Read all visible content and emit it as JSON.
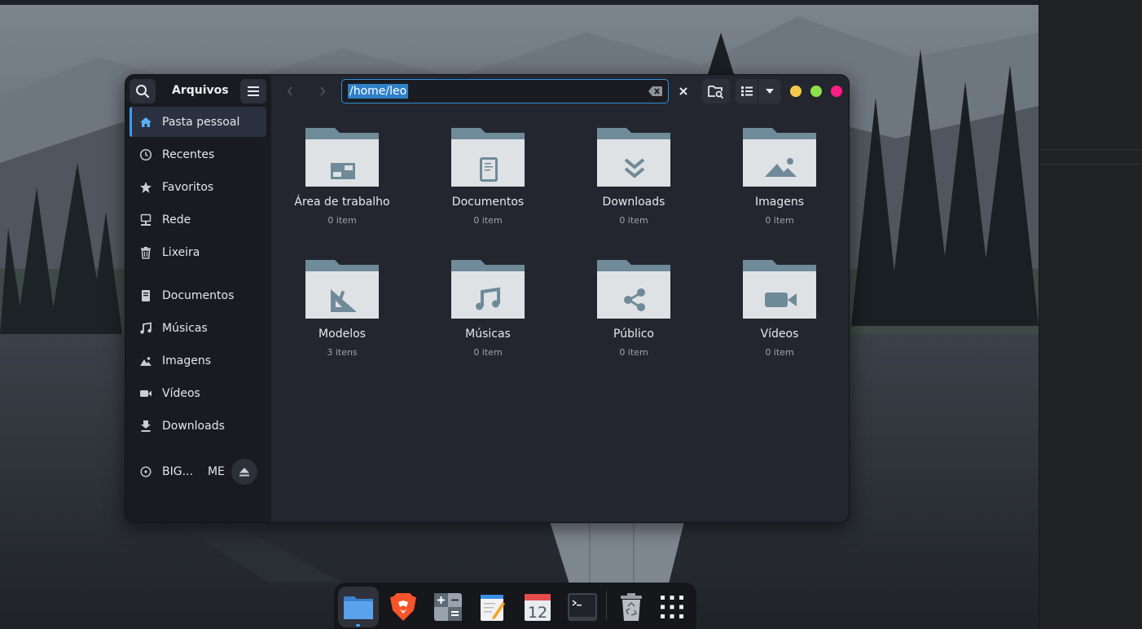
{
  "window": {
    "title": "Arquivos",
    "path": "/home/leo"
  },
  "colors": {
    "accent": "#3d9df3",
    "folder_back": "#6f8a99",
    "folder_front": "#dfe2e4",
    "dot_yellow": "#f5c84c",
    "dot_green": "#8de04a",
    "dot_pink": "#ff1d86"
  },
  "sidebar": {
    "places": [
      {
        "label": "Pasta pessoal",
        "icon": "home-icon"
      },
      {
        "label": "Recentes",
        "icon": "clock-icon"
      },
      {
        "label": "Favoritos",
        "icon": "star-icon"
      },
      {
        "label": "Rede",
        "icon": "network-icon"
      },
      {
        "label": "Lixeira",
        "icon": "trash-icon"
      }
    ],
    "bookmarks": [
      {
        "label": "Documentos",
        "icon": "document-icon"
      },
      {
        "label": "Músicas",
        "icon": "music-icon"
      },
      {
        "label": "Imagens",
        "icon": "image-icon"
      },
      {
        "label": "Vídeos",
        "icon": "video-icon"
      },
      {
        "label": "Downloads",
        "icon": "download-icon"
      }
    ],
    "device": {
      "label": "BIG...",
      "suffix": "ME",
      "icon": "disc-icon"
    }
  },
  "folders": [
    {
      "name": "Área de trabalho",
      "count": "0 item",
      "emblem": "desktop-emblem"
    },
    {
      "name": "Documentos",
      "count": "0 item",
      "emblem": "document-emblem"
    },
    {
      "name": "Downloads",
      "count": "0 item",
      "emblem": "download-emblem"
    },
    {
      "name": "Imagens",
      "count": "0 item",
      "emblem": "image-emblem"
    },
    {
      "name": "Modelos",
      "count": "3 itens",
      "emblem": "template-emblem"
    },
    {
      "name": "Músicas",
      "count": "0 item",
      "emblem": "music-emblem"
    },
    {
      "name": "Público",
      "count": "0 item",
      "emblem": "share-emblem"
    },
    {
      "name": "Vídeos",
      "count": "0 item",
      "emblem": "video-emblem"
    }
  ],
  "dock": {
    "calendar_day": "12",
    "apps": [
      "files-icon",
      "brave-icon",
      "calculator-icon",
      "text-editor-icon",
      "calendar-icon",
      "terminal-icon",
      "trash-icon",
      "app-grid-icon"
    ]
  }
}
